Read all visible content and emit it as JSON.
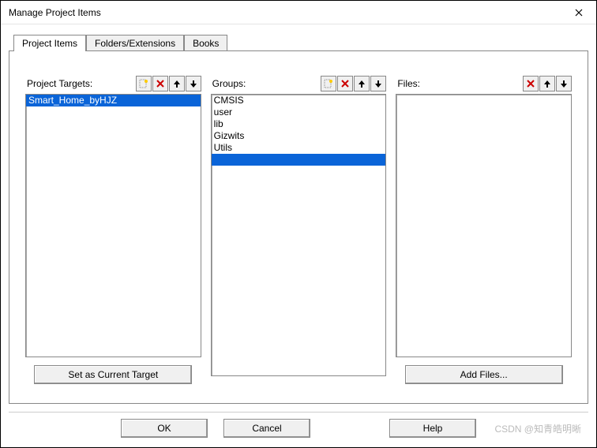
{
  "window": {
    "title": "Manage Project Items"
  },
  "tabs": {
    "items": [
      {
        "label": "Project Items",
        "active": true
      },
      {
        "label": "Folders/Extensions",
        "active": false
      },
      {
        "label": "Books",
        "active": false
      }
    ]
  },
  "columns": {
    "targets": {
      "label": "Project Targets:",
      "items": [
        "Smart_Home_byHJZ"
      ],
      "selected_index": 0,
      "has_new": true,
      "button": "Set as Current Target"
    },
    "groups": {
      "label": "Groups:",
      "items": [
        "CMSIS",
        "user",
        "lib",
        "Gizwits",
        "Utils"
      ],
      "selected_index": 5,
      "has_new": true
    },
    "files": {
      "label": "Files:",
      "items": [],
      "has_new": false,
      "button": "Add Files..."
    }
  },
  "dialog": {
    "ok": "OK",
    "cancel": "Cancel",
    "help": "Help"
  },
  "watermark": "CSDN @知青皓明晰"
}
